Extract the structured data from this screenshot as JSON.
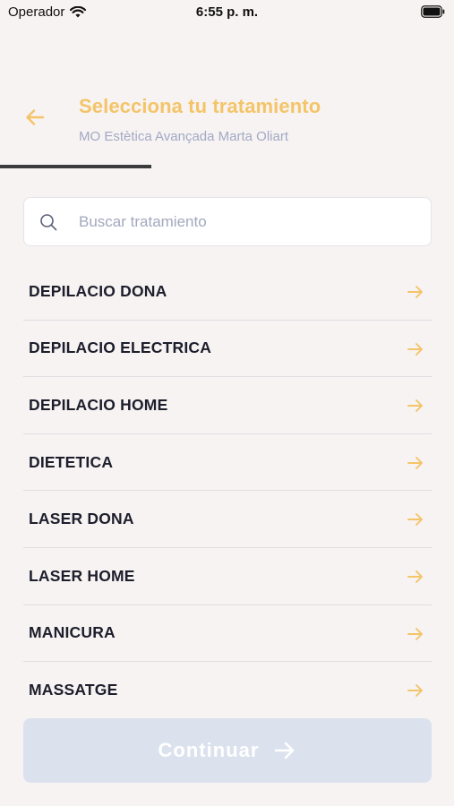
{
  "status_bar": {
    "carrier": "Operador",
    "time": "6:55 p. m."
  },
  "header": {
    "title": "Selecciona tu tratamiento",
    "subtitle": "MO Estètica Avançada Marta Oliart",
    "progress": 0.333
  },
  "search": {
    "placeholder": "Buscar tratamiento",
    "value": ""
  },
  "treatments": [
    {
      "label": "DEPILACIO DONA"
    },
    {
      "label": "DEPILACIO ELECTRICA"
    },
    {
      "label": "DEPILACIO HOME"
    },
    {
      "label": "DIETETICA"
    },
    {
      "label": "LASER DONA"
    },
    {
      "label": "LASER HOME"
    },
    {
      "label": "MANICURA"
    },
    {
      "label": "MASSATGE"
    }
  ],
  "continue_button": {
    "label": "Continuar"
  },
  "colors": {
    "accent": "#f4c468",
    "subtitle": "#a2a9c6",
    "background": "#f7f3f2",
    "button_disabled": "#dbe2ee"
  },
  "icons": {
    "back": "arrow-left-icon",
    "search": "search-icon",
    "item": "arrow-right-icon",
    "continue": "arrow-right-icon",
    "wifi": "wifi-icon",
    "battery": "battery-icon"
  }
}
